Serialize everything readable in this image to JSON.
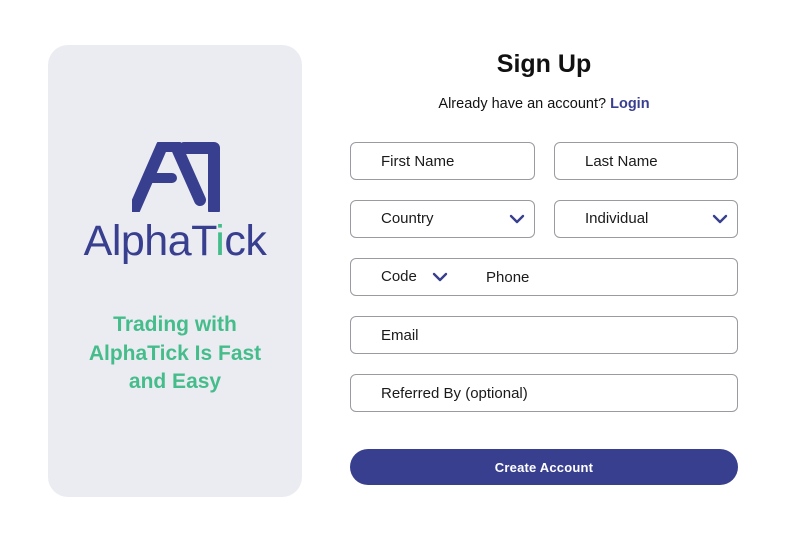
{
  "brand": {
    "name_main": "AlphaT",
    "name_accent": "i",
    "name_rest": "ck",
    "tagline": "Trading with AlphaTick Is Fast and Easy",
    "colors": {
      "primary": "#383f8f",
      "accent": "#45bd8b",
      "panel_bg": "#ebebf2"
    },
    "logo_icon": "alphatick-logo-icon"
  },
  "form": {
    "title": "Sign Up",
    "login_prompt": "Already have an account?",
    "login_link": "Login",
    "first_name_placeholder": "First Name",
    "last_name_placeholder": "Last Name",
    "country_label": "Country",
    "account_type_label": "Individual",
    "phone_code_label": "Code",
    "phone_placeholder": "Phone",
    "email_placeholder": "Email",
    "referred_by_placeholder": "Referred By (optional)",
    "submit_label": "Create Account",
    "chevron_icon": "chevron-down-icon"
  }
}
